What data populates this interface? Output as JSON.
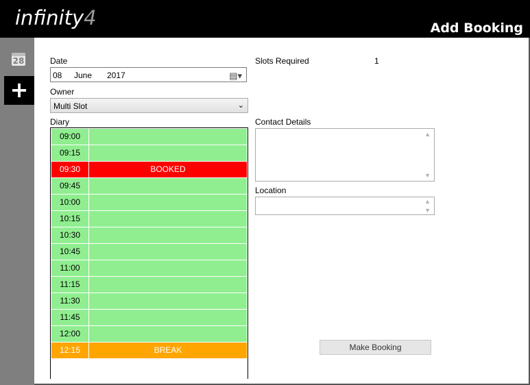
{
  "app": {
    "logo_text": "infinity",
    "logo_num": "4",
    "page_title": "Add Booking"
  },
  "sidebar": {
    "calendar_day": "28",
    "add_glyph": "+"
  },
  "form": {
    "date_label": "Date",
    "date_day": "08",
    "date_month": "June",
    "date_year": "2017",
    "owner_label": "Owner",
    "owner_value": "Multi Slot",
    "diary_label": "Diary",
    "slots_required_label": "Slots Required",
    "slots_required_value": "1",
    "contact_label": "Contact Details",
    "contact_value": "",
    "location_label": "Location",
    "location_value": "",
    "make_booking_label": "Make Booking"
  },
  "diary": {
    "slots": [
      {
        "time": "09:00",
        "status": "",
        "state": "free"
      },
      {
        "time": "09:15",
        "status": "",
        "state": "free"
      },
      {
        "time": "09:30",
        "status": "BOOKED",
        "state": "booked"
      },
      {
        "time": "09:45",
        "status": "",
        "state": "free"
      },
      {
        "time": "10:00",
        "status": "",
        "state": "free"
      },
      {
        "time": "10:15",
        "status": "",
        "state": "free"
      },
      {
        "time": "10:30",
        "status": "",
        "state": "free"
      },
      {
        "time": "10:45",
        "status": "",
        "state": "free"
      },
      {
        "time": "11:00",
        "status": "",
        "state": "free"
      },
      {
        "time": "11:15",
        "status": "",
        "state": "free"
      },
      {
        "time": "11:30",
        "status": "",
        "state": "free"
      },
      {
        "time": "11:45",
        "status": "",
        "state": "free"
      },
      {
        "time": "12:00",
        "status": "",
        "state": "free"
      },
      {
        "time": "12:15",
        "status": "BREAK",
        "state": "break"
      }
    ]
  },
  "colors": {
    "free": "#90ee90",
    "booked": "#ff0000",
    "break": "#ffa500",
    "header": "#000000",
    "sidebar": "#7f7f7f"
  },
  "icons": {
    "calendar": "calendar-icon",
    "add": "plus-icon",
    "date_picker": "calendar-dropdown-icon",
    "select": "chevron-down-icon"
  }
}
